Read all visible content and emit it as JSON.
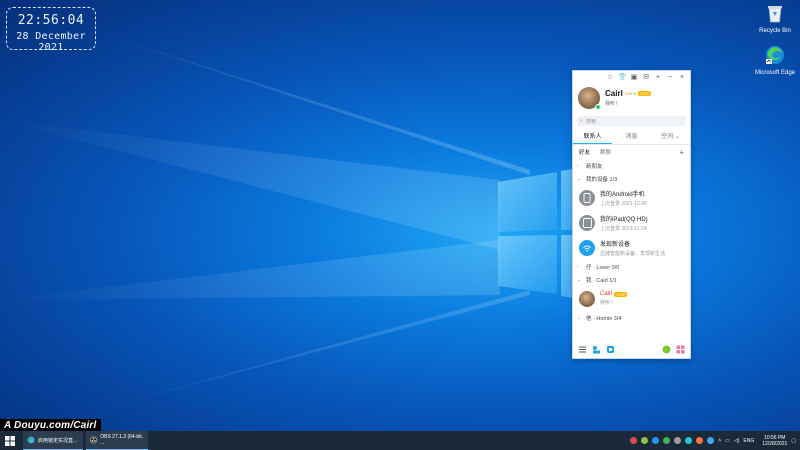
{
  "clock": {
    "time": "22:56:04",
    "date": "28 December 2021"
  },
  "desktop": {
    "icons": [
      {
        "label": "Recycle Bin",
        "icon": "recycle-bin-icon"
      },
      {
        "label": "Microsoft Edge",
        "icon": "edge-icon"
      }
    ],
    "watermark": "A Douyu.com/Cairl"
  },
  "qq": {
    "profile": {
      "name": "Cairl",
      "badge_svip": "SVIP8",
      "badge_tag": "SVIP",
      "signature": "我听！"
    },
    "search_placeholder": "搜索",
    "tabs": [
      "联系人",
      "消息",
      "空间"
    ],
    "subtabs": [
      "好友",
      "群聊"
    ],
    "groups": {
      "new_friends": "新朋友",
      "my_devices": "我的设备  1/3",
      "lover": "仔 · Lover  0/0",
      "cairl": "我 · Cairl  1/1",
      "homie": "他 · Homie  3/4"
    },
    "devices": [
      {
        "name": "我的Android手机",
        "sub": "上次登录 2021-12-28"
      },
      {
        "name": "我的iPad(QQ HD)",
        "sub": "上次登录 2021-11-24"
      },
      {
        "name": "发现新设备",
        "sub": "迅捷智能新设备，发现新生活"
      }
    ],
    "friend": {
      "name": "Cairl",
      "tag": "SVIP",
      "sub": "我听！"
    },
    "colors": {
      "accent": "#12b7f5",
      "online": "#2bd15b",
      "vip": "#ffb400"
    }
  },
  "taskbar": {
    "buttons": [
      "启用锁定实况直...",
      "OBS 27.1.3 (64-bit, ..."
    ],
    "lang": "ENG",
    "time": "10:56 PM",
    "date": "12/28/2021"
  }
}
